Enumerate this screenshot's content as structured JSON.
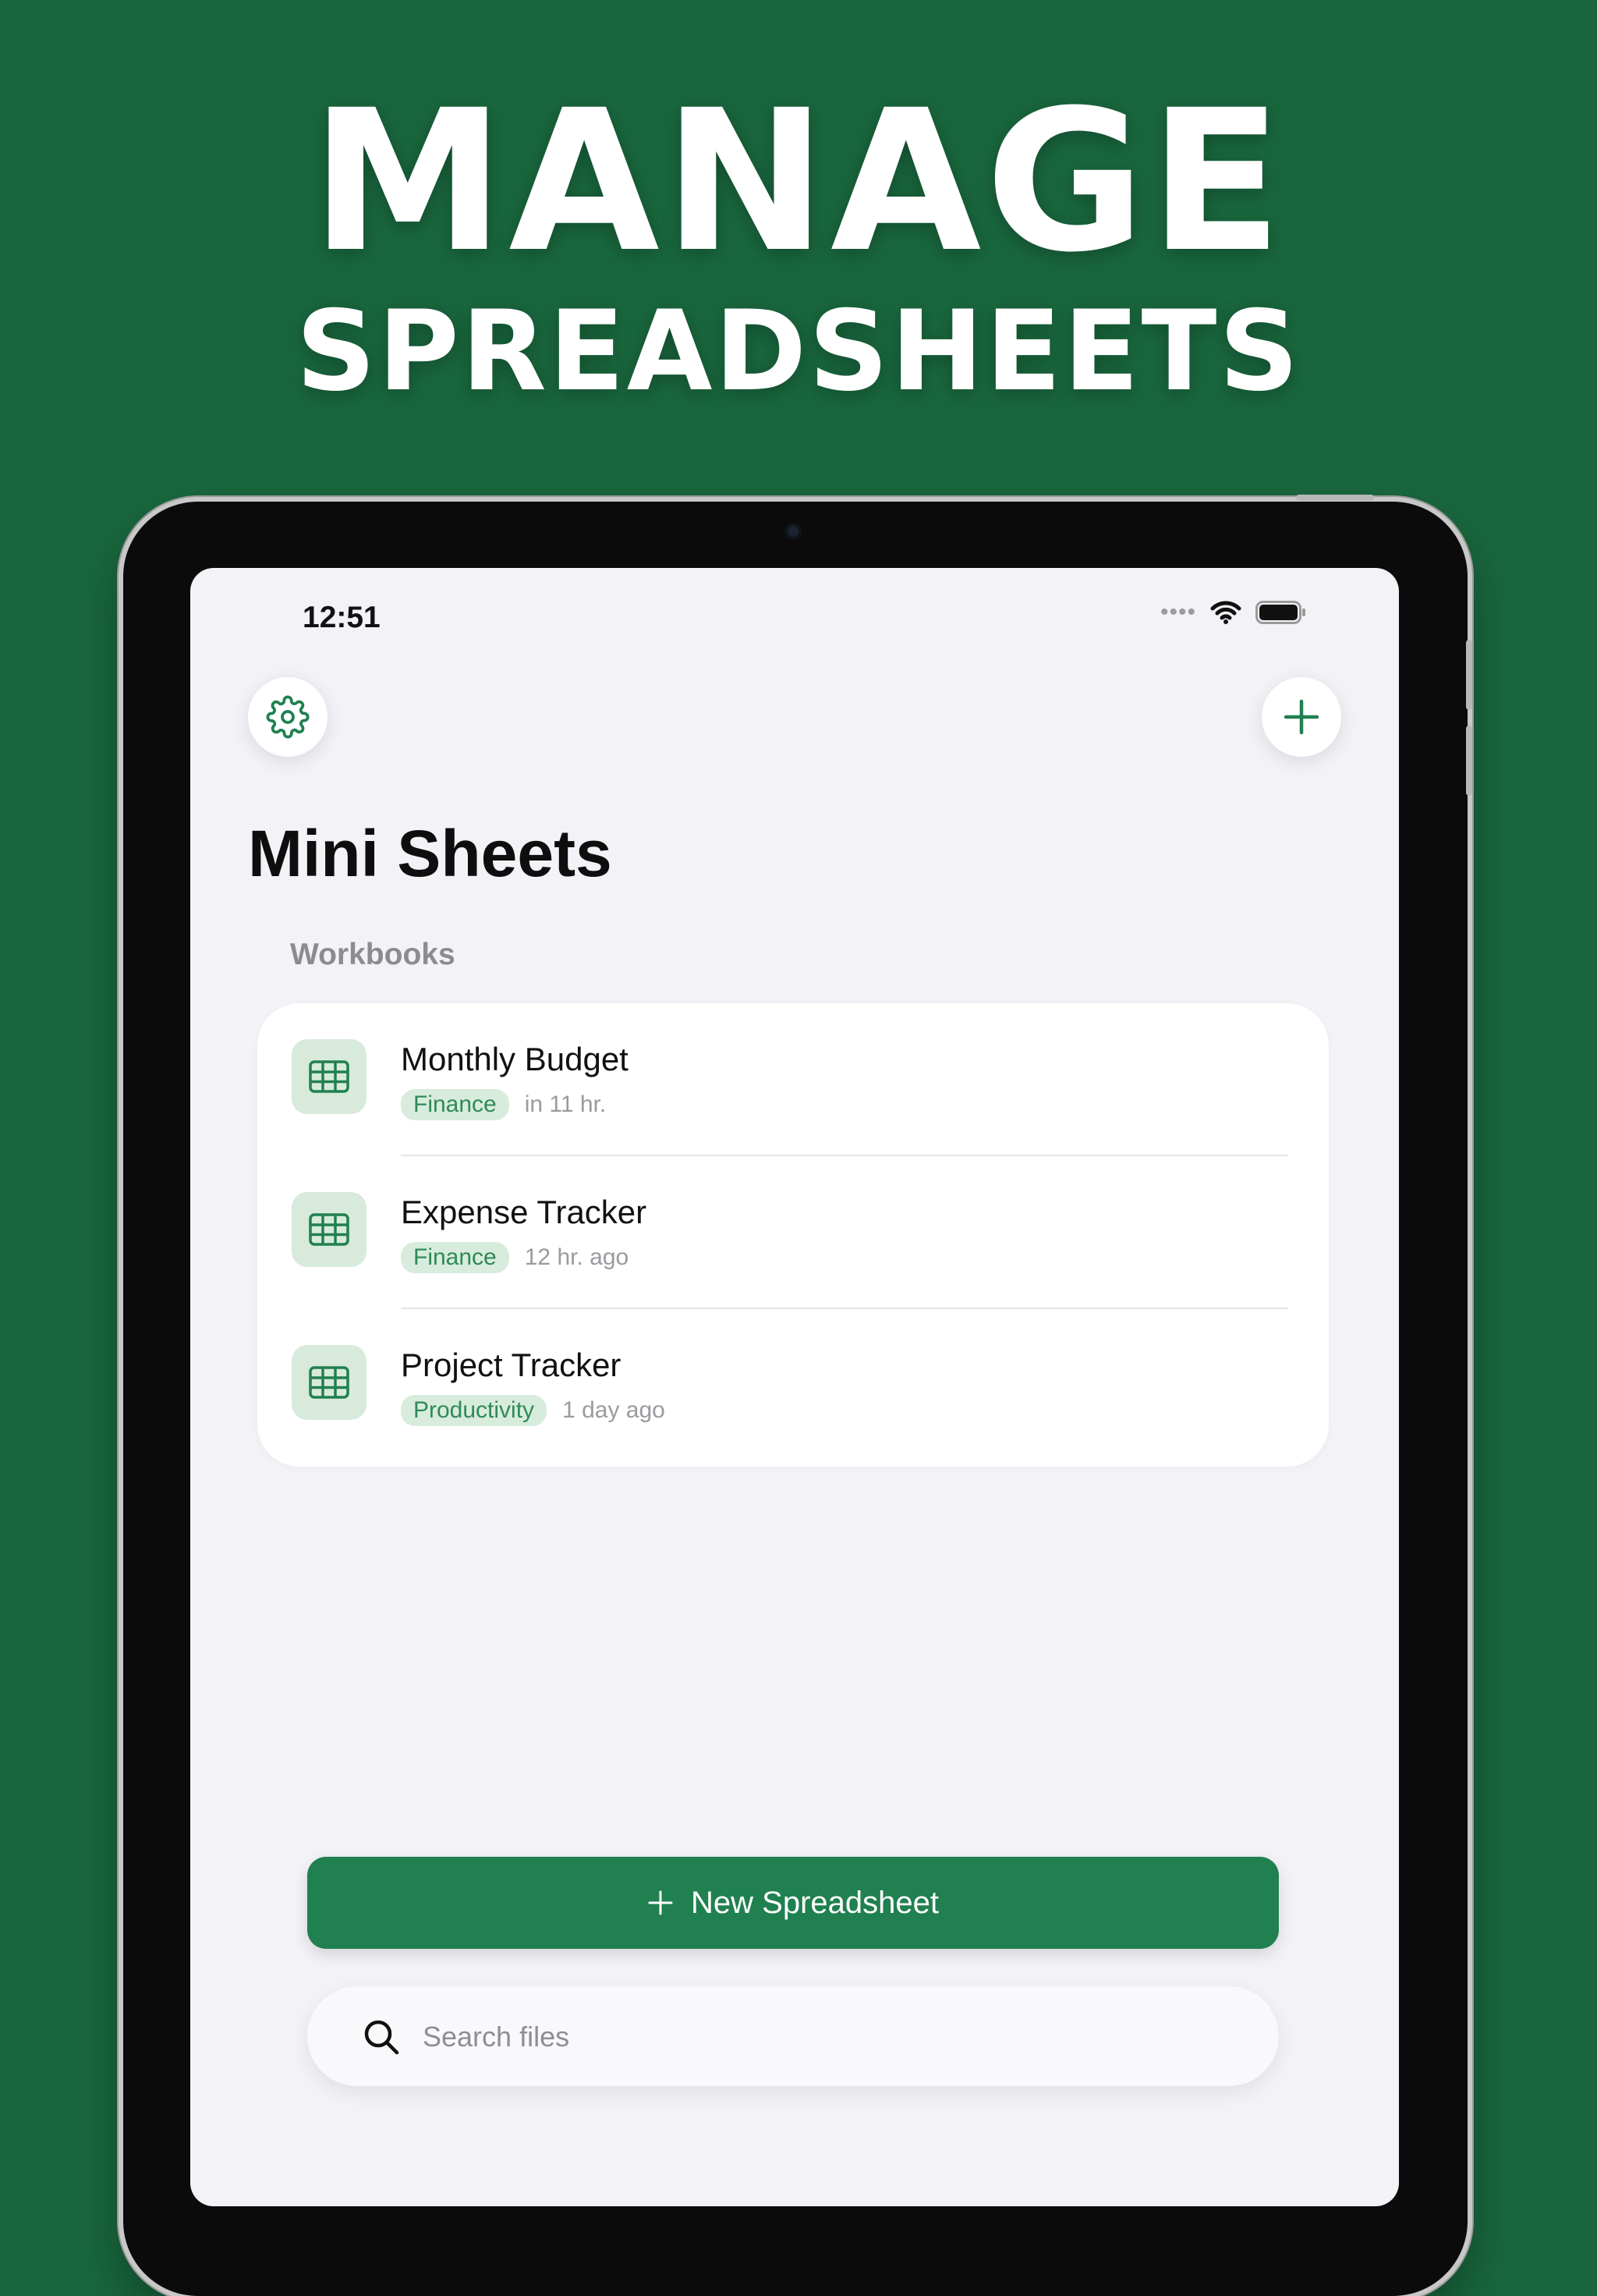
{
  "marketing": {
    "headline_line1": "MANAGE",
    "headline_line2": "SPREADSHEETS",
    "background_color": "#19663d"
  },
  "status_bar": {
    "time": "12:51",
    "signal_icon": "signal-dots-icon",
    "wifi_icon": "wifi-icon",
    "battery_icon": "battery-icon"
  },
  "toolbar": {
    "settings_icon": "gear-icon",
    "add_icon": "plus-icon",
    "accent_color": "#208050"
  },
  "page": {
    "title": "Mini Sheets",
    "section_label": "Workbooks"
  },
  "workbooks": [
    {
      "name": "Monthly Budget",
      "tag": "Finance",
      "time": "in 11 hr.",
      "icon": "table-icon"
    },
    {
      "name": "Expense Tracker",
      "tag": "Finance",
      "time": "12 hr. ago",
      "icon": "table-icon"
    },
    {
      "name": "Project Tracker",
      "tag": "Productivity",
      "time": "1 day ago",
      "icon": "table-icon"
    }
  ],
  "actions": {
    "new_spreadsheet_label": "New Spreadsheet"
  },
  "search": {
    "placeholder": "Search files",
    "value": ""
  }
}
